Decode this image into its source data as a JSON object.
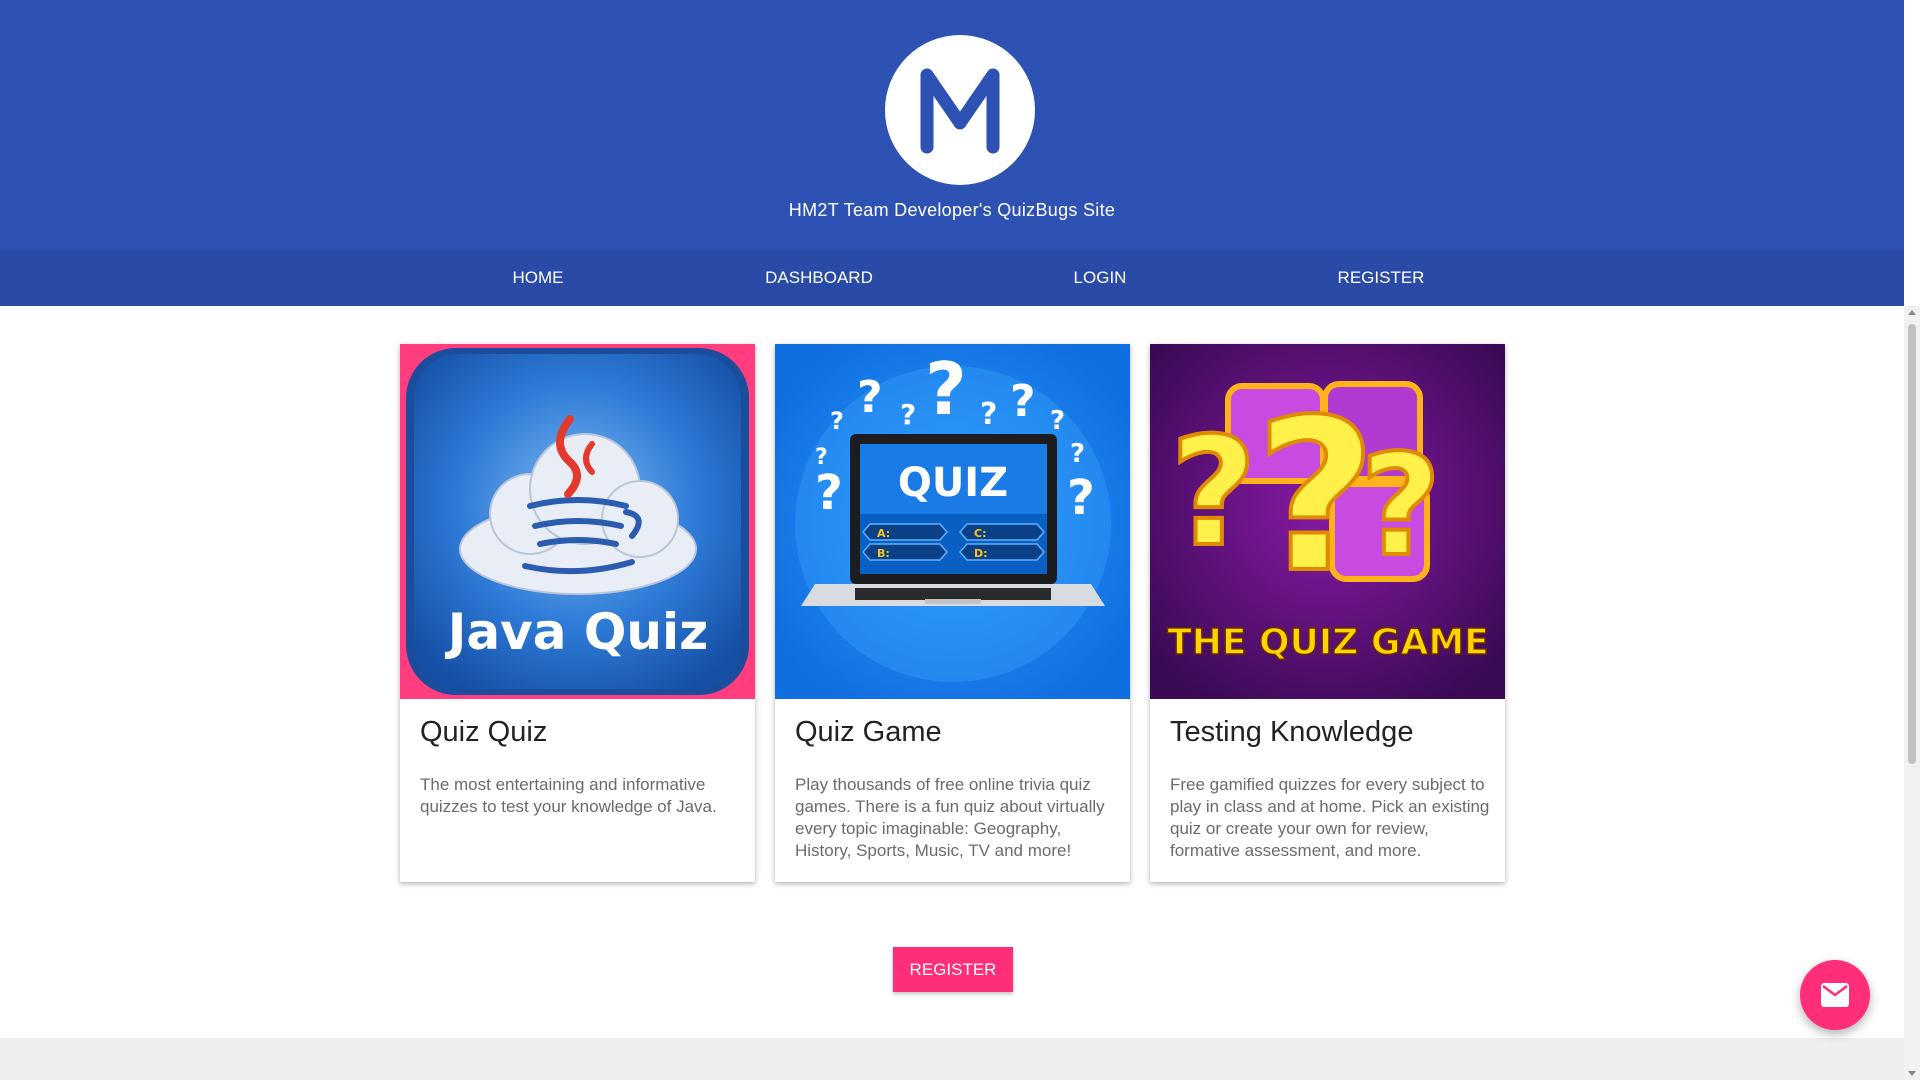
{
  "header": {
    "logo_letter": "M",
    "site_title": "HM2T Team Developer's QuizBugs Site"
  },
  "nav": {
    "items": [
      {
        "label": "HOME"
      },
      {
        "label": "DASHBOARD"
      },
      {
        "label": "LOGIN"
      },
      {
        "label": "REGISTER"
      }
    ]
  },
  "cards": [
    {
      "image_text": "Java Quiz",
      "title": "Quiz Quiz",
      "text": "The most entertaining and informative quizzes to test your knowledge of Java."
    },
    {
      "image_text": "QUIZ",
      "image_options": [
        "A:",
        "C:",
        "B:",
        "D:"
      ],
      "title": "Quiz Game",
      "text": "Play thousands of free online trivia quiz games. There is a fun quiz about virtually every topic imaginable: Geography, History, Sports, Music, TV and more!"
    },
    {
      "image_text": "THE QUIZ GAME",
      "title": "Testing Knowledge",
      "text": "Free gamified quizzes for every subject to play in class and at home. Pick an existing quiz or create your own for review, formative assessment, and more."
    }
  ],
  "actions": {
    "register_label": "REGISTER"
  },
  "icons": {
    "fab": "mail-icon"
  },
  "colors": {
    "header_bg": "#2d52b4",
    "nav_bg": "#2a4aa8",
    "accent": "#ff2e7a"
  }
}
